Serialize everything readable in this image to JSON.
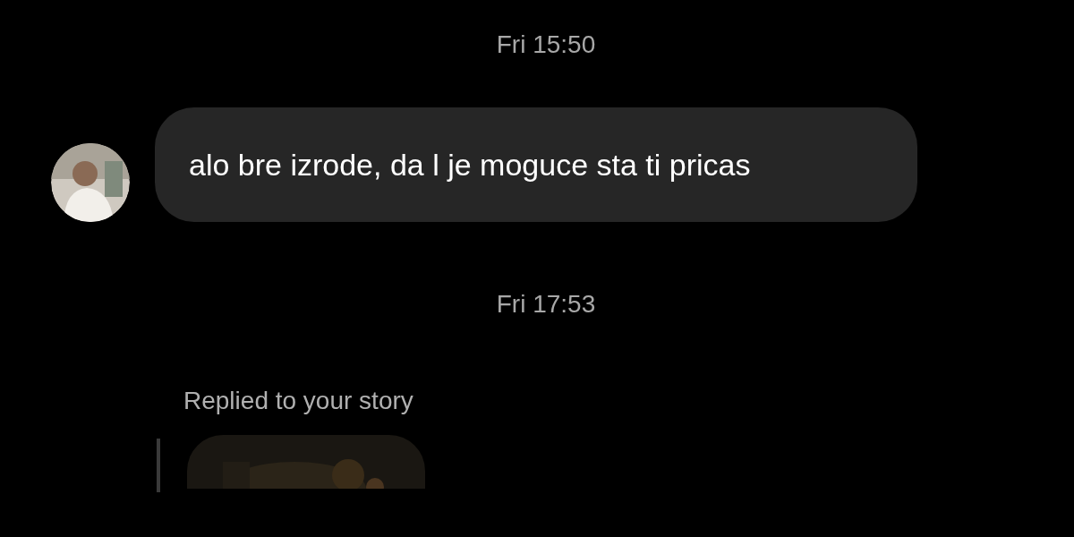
{
  "messages": [
    {
      "kind": "timestamp",
      "text": "Fri 15:50"
    },
    {
      "kind": "incoming",
      "text": "alo bre izrode, da l je moguce sta ti pricas"
    },
    {
      "kind": "timestamp",
      "text": "Fri 17:53"
    },
    {
      "kind": "story_reply",
      "label": "Replied to your story"
    }
  ]
}
